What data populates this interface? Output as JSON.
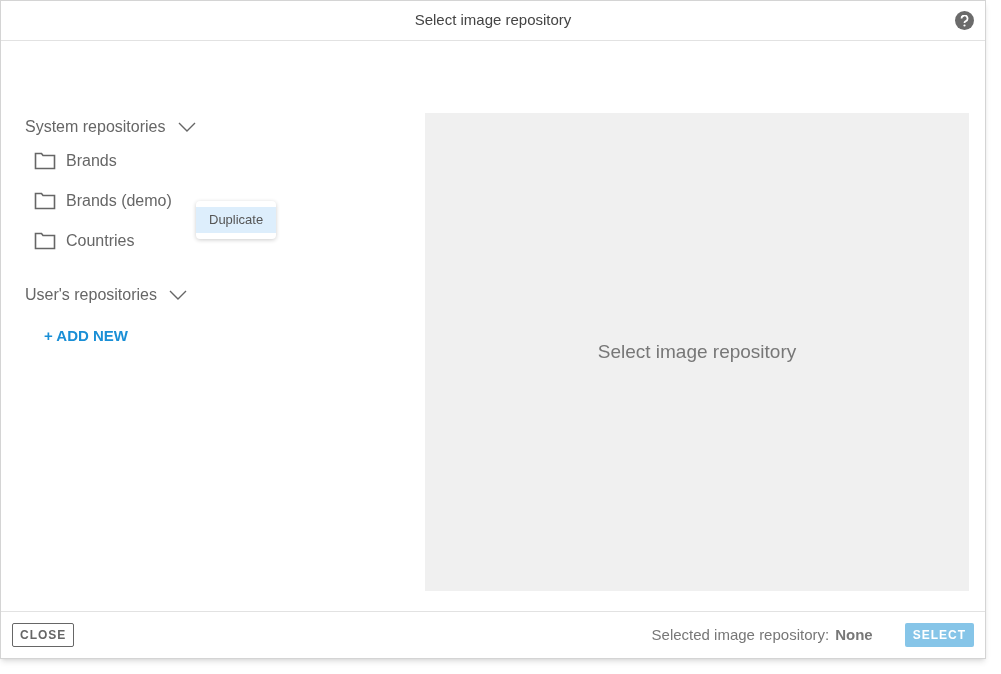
{
  "dialog": {
    "title": "Select image repository"
  },
  "sections": [
    {
      "title": "System repositories",
      "expanded": true,
      "items": [
        {
          "label": "Brands"
        },
        {
          "label": "Brands (demo)",
          "menu": [
            "Duplicate"
          ]
        },
        {
          "label": "Countries"
        }
      ]
    },
    {
      "title": "User's repositories",
      "expanded": true,
      "add_label": "+ ADD NEW"
    }
  ],
  "preview": {
    "text": "Select image repository"
  },
  "footer": {
    "close_label": "CLOSE",
    "selected_label": "Selected image repository:",
    "selected_value": "None",
    "select_label": "SELECT",
    "select_disabled": true
  }
}
